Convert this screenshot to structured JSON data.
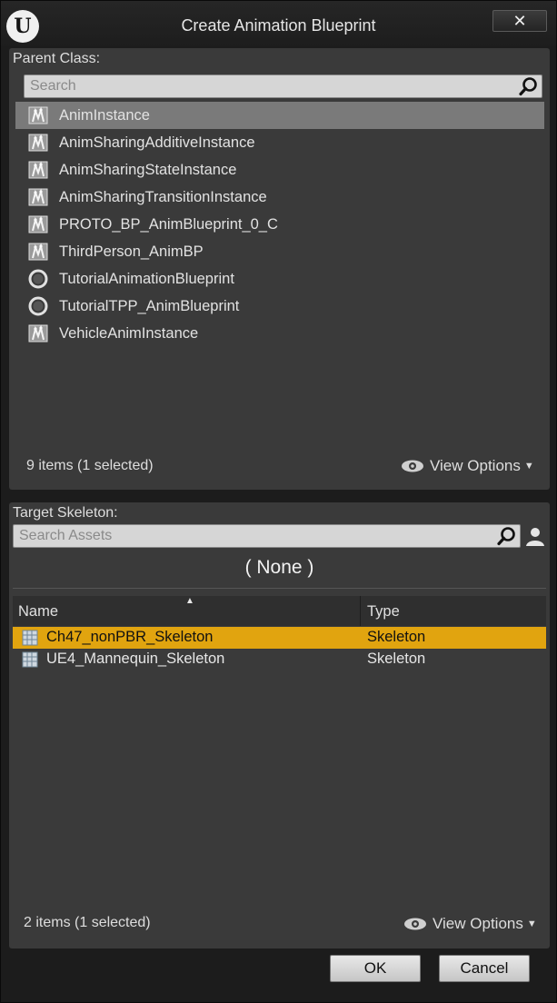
{
  "window": {
    "title": "Create Animation Blueprint",
    "close_glyph": "✕"
  },
  "parent_class": {
    "label": "Parent Class:",
    "search_placeholder": "Search",
    "items": [
      {
        "label": "AnimInstance",
        "icon": "anim-class-icon",
        "selected": true
      },
      {
        "label": "AnimSharingAdditiveInstance",
        "icon": "anim-class-icon",
        "selected": false
      },
      {
        "label": "AnimSharingStateInstance",
        "icon": "anim-class-icon",
        "selected": false
      },
      {
        "label": "AnimSharingTransitionInstance",
        "icon": "anim-class-icon",
        "selected": false
      },
      {
        "label": "PROTO_BP_AnimBlueprint_0_C",
        "icon": "anim-class-icon",
        "selected": false
      },
      {
        "label": "ThirdPerson_AnimBP",
        "icon": "anim-class-icon",
        "selected": false
      },
      {
        "label": "TutorialAnimationBlueprint",
        "icon": "circle-class-icon",
        "selected": false
      },
      {
        "label": "TutorialTPP_AnimBlueprint",
        "icon": "circle-class-icon",
        "selected": false
      },
      {
        "label": "VehicleAnimInstance",
        "icon": "anim-class-icon",
        "selected": false
      }
    ],
    "count_text": "9 items (1 selected)",
    "view_options": "View Options"
  },
  "target_skeleton": {
    "label": "Target Skeleton:",
    "search_placeholder": "Search Assets",
    "none_label": "( None )",
    "columns": {
      "name": "Name",
      "type": "Type"
    },
    "rows": [
      {
        "name": "Ch47_nonPBR_Skeleton",
        "type": "Skeleton",
        "selected": true
      },
      {
        "name": "UE4_Mannequin_Skeleton",
        "type": "Skeleton",
        "selected": false
      }
    ],
    "count_text": "2 items (1 selected)",
    "view_options": "View Options"
  },
  "buttons": {
    "ok": "OK",
    "cancel": "Cancel"
  },
  "colors": {
    "selection_highlight": "#e1a40f",
    "list_selection": "#7a7a7a",
    "panel_bg": "#3a3a3a"
  }
}
